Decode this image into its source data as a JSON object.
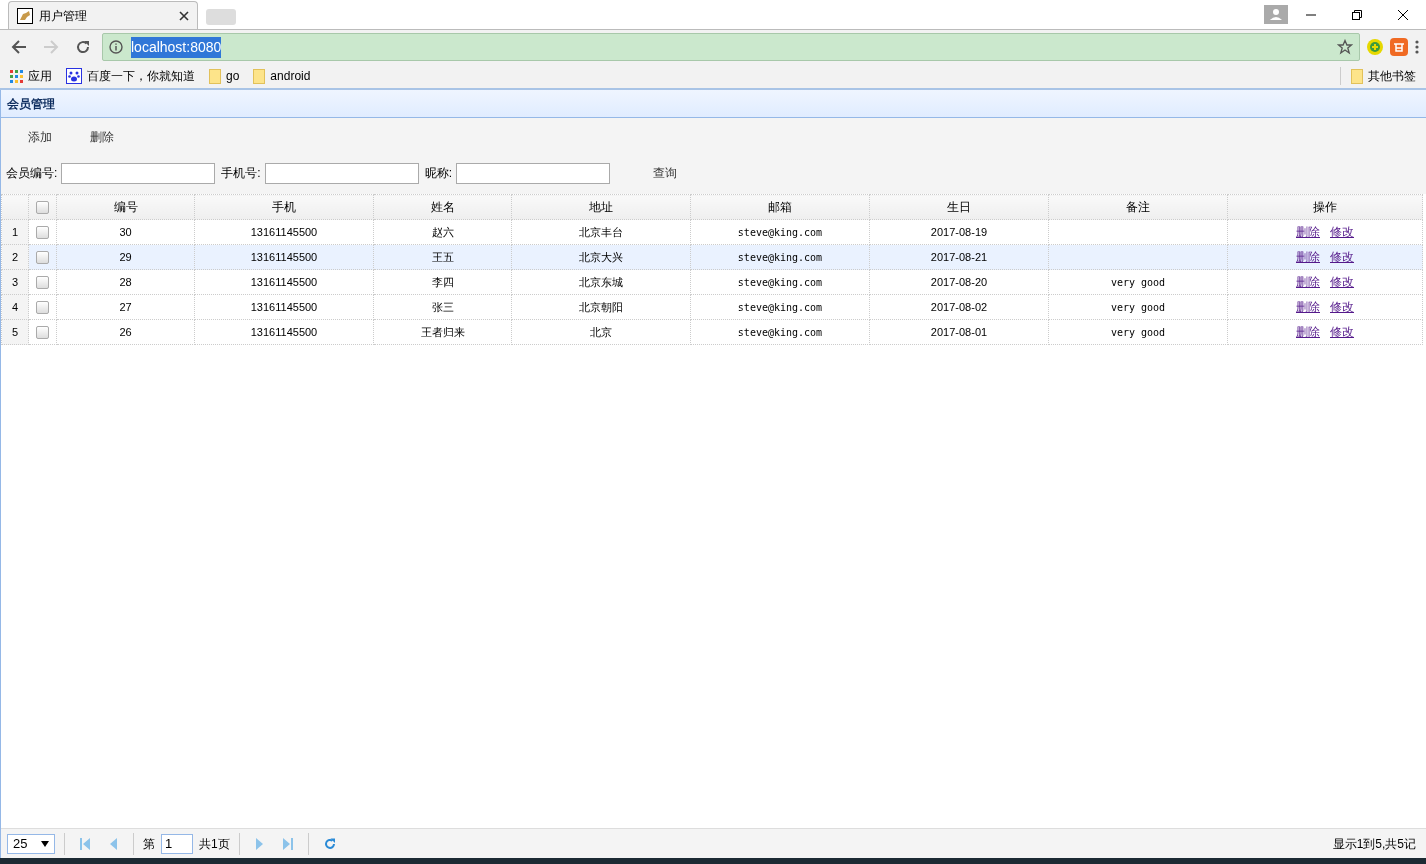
{
  "browser": {
    "tab_title": "用户管理",
    "address": "localhost:8080",
    "bookmarks": [
      {
        "label": "应用",
        "kind": "apps"
      },
      {
        "label": "百度一下，你就知道",
        "kind": "site"
      },
      {
        "label": "go",
        "kind": "folder"
      },
      {
        "label": "android",
        "kind": "folder"
      }
    ],
    "other_bookmarks": "其他书签"
  },
  "panel": {
    "title": "会员管理",
    "toolbar": [
      "添加",
      "删除"
    ],
    "search": {
      "fields": [
        {
          "label": "会员编号:"
        },
        {
          "label": "手机号:"
        },
        {
          "label": "昵称:"
        }
      ],
      "button": "查询"
    }
  },
  "table": {
    "header_checked": false,
    "columns": [
      "编号",
      "手机",
      "姓名",
      "地址",
      "邮箱",
      "生日",
      "备注",
      "操作"
    ],
    "rows": [
      {
        "index": "1",
        "checked": false,
        "selected": false,
        "cells": [
          "30",
          "13161145500",
          "赵六",
          "北京丰台",
          "steve@king.com",
          "2017-08-19",
          ""
        ],
        "actions": [
          "删除",
          "修改"
        ]
      },
      {
        "index": "2",
        "checked": false,
        "selected": true,
        "cells": [
          "29",
          "13161145500",
          "王五",
          "北京大兴",
          "steve@king.com",
          "2017-08-21",
          ""
        ],
        "actions": [
          "删除",
          "修改"
        ]
      },
      {
        "index": "3",
        "checked": false,
        "selected": false,
        "cells": [
          "28",
          "13161145500",
          "李四",
          "北京东城",
          "steve@king.com",
          "2017-08-20",
          "very good"
        ],
        "actions": [
          "删除",
          "修改"
        ]
      },
      {
        "index": "4",
        "checked": false,
        "selected": false,
        "cells": [
          "27",
          "13161145500",
          "张三",
          "北京朝阳",
          "steve@king.com",
          "2017-08-02",
          "very good"
        ],
        "actions": [
          "删除",
          "修改"
        ]
      },
      {
        "index": "5",
        "checked": false,
        "selected": false,
        "cells": [
          "26",
          "13161145500",
          "王者归来",
          "北京",
          "steve@king.com",
          "2017-08-01",
          "very good"
        ],
        "actions": [
          "删除",
          "修改"
        ]
      }
    ]
  },
  "pager": {
    "page_size": "25",
    "before": "第",
    "page": "1",
    "after": "共1页",
    "summary": "显示1到5,共5记"
  }
}
